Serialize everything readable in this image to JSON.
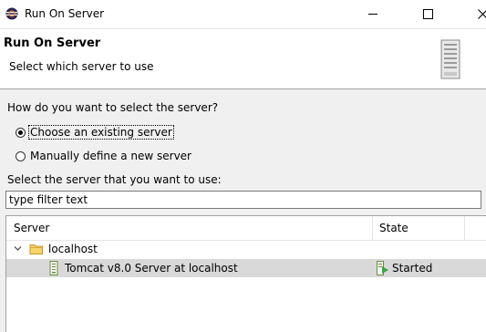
{
  "window": {
    "title": "Run On Server",
    "icon": "eclipse-icon",
    "controls": [
      "minimize",
      "maximize",
      "close"
    ]
  },
  "header": {
    "title": "Run On Server",
    "subtitle": "Select which server to use",
    "graphic": "server-tower-icon"
  },
  "form": {
    "question": "How do you want to select the server?",
    "options": [
      {
        "label": "Choose an existing server",
        "selected": true
      },
      {
        "label": "Manually define a new server",
        "selected": false
      }
    ],
    "select_label": "Select the server that you want to use:",
    "filter_value": "type filter text"
  },
  "table": {
    "columns": [
      "Server",
      "State"
    ],
    "rows": [
      {
        "label": "localhost",
        "icon": "folder-icon",
        "expanded": true
      },
      {
        "label": "Tomcat v8.0 Server at localhost",
        "icon": "tomcat-server-icon",
        "state": "Started",
        "state_icon": "started-icon",
        "selected": true
      }
    ]
  }
}
